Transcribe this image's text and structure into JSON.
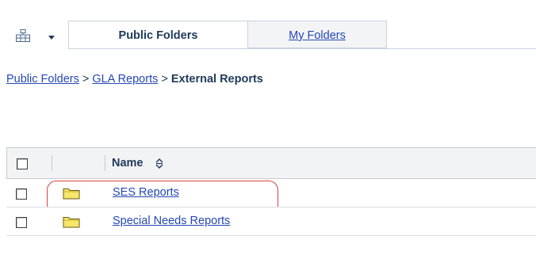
{
  "toolbar": {
    "view_icon": "folder-tree-icon",
    "dropdown_icon": "caret-down-icon"
  },
  "tabs": [
    {
      "label": "Public Folders",
      "active": true
    },
    {
      "label": "My Folders",
      "active": false
    }
  ],
  "breadcrumb": {
    "items": [
      "Public Folders",
      "GLA Reports"
    ],
    "separator": ">",
    "current": "External Reports"
  },
  "table": {
    "header": {
      "name": "Name",
      "sort_icon": "sort-toggle-icon"
    },
    "rows": [
      {
        "name": "SES Reports",
        "icon": "folder-icon",
        "checked": false,
        "highlighted": true
      },
      {
        "name": "Special Needs Reports",
        "icon": "folder-icon",
        "checked": false,
        "highlighted": false
      }
    ]
  },
  "colors": {
    "link": "#2447b5",
    "text": "#1f3a5a",
    "folder": "#f7e66a",
    "highlight": "#d8413f"
  }
}
